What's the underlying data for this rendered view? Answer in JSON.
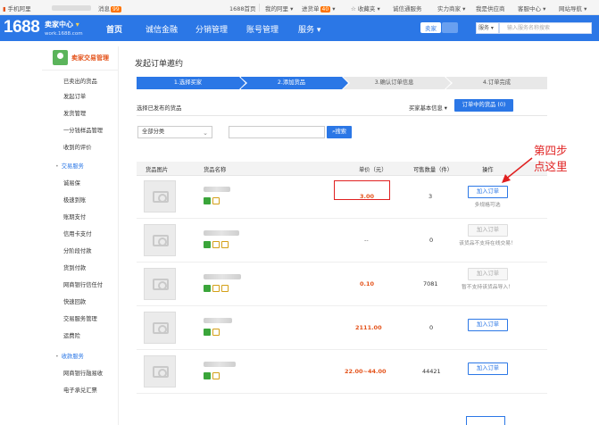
{
  "topbar": {
    "mobile": "手机阿里",
    "user_blur": "",
    "messages": "消息",
    "messages_count": "99",
    "home": "1688首页",
    "my_ali": "我的阿里",
    "purchase": "进货单",
    "purchase_count": "40",
    "favorites": "收藏夹",
    "supply": "诚信通服务",
    "power_merchant": "实力商家",
    "supplier_apps": "我是供应商",
    "service_center": "客服中心",
    "site_nav": "网站导航"
  },
  "header": {
    "logo": "1688",
    "seller_center": "卖家中心",
    "url": "work.1688.com",
    "nav": [
      "首页",
      "诚信金融",
      "分销管理",
      "账号管理",
      "服务"
    ],
    "seller_btn": "卖家",
    "buyer_btn": "",
    "search_scope": "服务",
    "search_placeholder": "输入服务名称搜索"
  },
  "sidebar": {
    "title": "卖家交易管理",
    "group1": [
      "已卖出的货品",
      "发起订单",
      "发货管理",
      "一分钱样品管理",
      "收到的评价"
    ],
    "section_trade": "交易服务",
    "group2": [
      "诚易保",
      "极速到账",
      "账期支付",
      "信用卡支付",
      "分阶段付款",
      "货到付款",
      "网商银行信任付",
      "快速回款",
      "交易服务管理",
      "运费险"
    ],
    "section_collect": "收款服务",
    "group3": [
      "网商银行融易收",
      "电子承兑汇票"
    ]
  },
  "main": {
    "page_title": "发起订单邀约",
    "steps": [
      "1.选择买家",
      "2.添加货品",
      "3.确认订单信息",
      "4.订单完成"
    ],
    "sub_label": "选择已发布的货品",
    "buyer_info": "买家基本信息",
    "order_goods_tab": "订单中的货品 (0)",
    "category": "全部分类",
    "search_btn": "搜索",
    "columns": [
      "货品图片",
      "货品名称",
      "单价（元）",
      "可售数量（件）",
      "操作"
    ],
    "add_btn": "加入订单",
    "rows": [
      {
        "price": "3.00",
        "qty": "3",
        "note": "多规格可选",
        "enabled": true
      },
      {
        "price": "--",
        "qty": "0",
        "note": "该货品不支持在线交易！",
        "enabled": false
      },
      {
        "price": "0.10",
        "qty": "7081",
        "note": "暂不支持该货品导入！",
        "enabled": false
      },
      {
        "price": "2111.00",
        "qty": "0",
        "note": "",
        "enabled": true
      },
      {
        "price": "22.00~44.00",
        "qty": "44421",
        "note": "",
        "enabled": true
      }
    ]
  },
  "annotation": {
    "line1": "第四步",
    "line2": "点这里",
    "color": "#e02020"
  },
  "colors": {
    "brand_blue": "#2b77e6",
    "price_orange": "#e4531b"
  }
}
